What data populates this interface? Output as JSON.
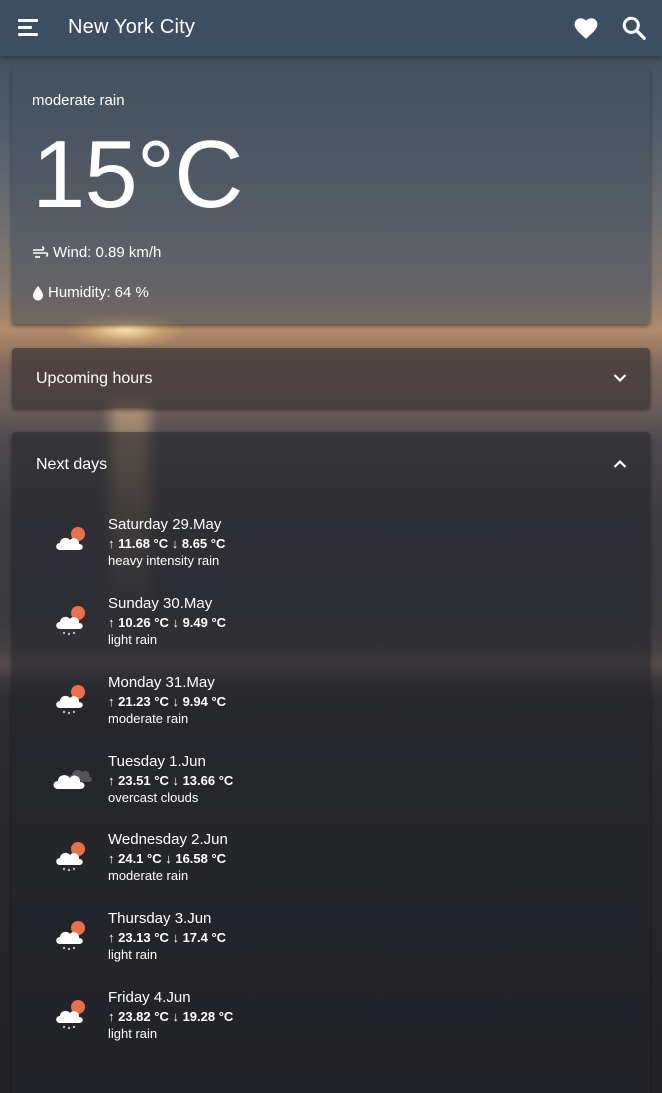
{
  "app": {
    "city": "New York City"
  },
  "current": {
    "description": "moderate rain",
    "temperature": "15°C",
    "wind": "Wind: 0.89 km/h",
    "humidity": "Humidity: 64 %"
  },
  "panels": {
    "upcoming_hours": "Upcoming hours",
    "next_days": "Next days"
  },
  "days": [
    {
      "name": "Saturday 29.May",
      "temps": "↑ 11.68 °C ↓ 8.65 °C",
      "desc": "heavy intensity rain",
      "icon": "rain-cloud-icon"
    },
    {
      "name": "Sunday 30.May",
      "temps": "↑ 10.26 °C ↓ 9.49 °C",
      "desc": "light rain",
      "icon": "rain-cloud-icon"
    },
    {
      "name": "Monday 31.May",
      "temps": "↑ 21.23 °C ↓ 9.94 °C",
      "desc": "moderate rain",
      "icon": "rain-cloud-icon"
    },
    {
      "name": "Tuesday 1.Jun",
      "temps": "↑ 23.51 °C ↓ 13.66 °C",
      "desc": "overcast clouds",
      "icon": "overcast-clouds-icon"
    },
    {
      "name": "Wednesday 2.Jun",
      "temps": "↑ 24.1 °C ↓ 16.58 °C",
      "desc": "moderate rain",
      "icon": "rain-cloud-icon"
    },
    {
      "name": "Thursday 3.Jun",
      "temps": "↑ 23.13 °C ↓ 17.4 °C",
      "desc": "light rain",
      "icon": "rain-cloud-icon"
    },
    {
      "name": "Friday 4.Jun",
      "temps": "↑ 23.82 °C ↓ 19.28 °C",
      "desc": "light rain",
      "icon": "rain-cloud-icon"
    }
  ]
}
